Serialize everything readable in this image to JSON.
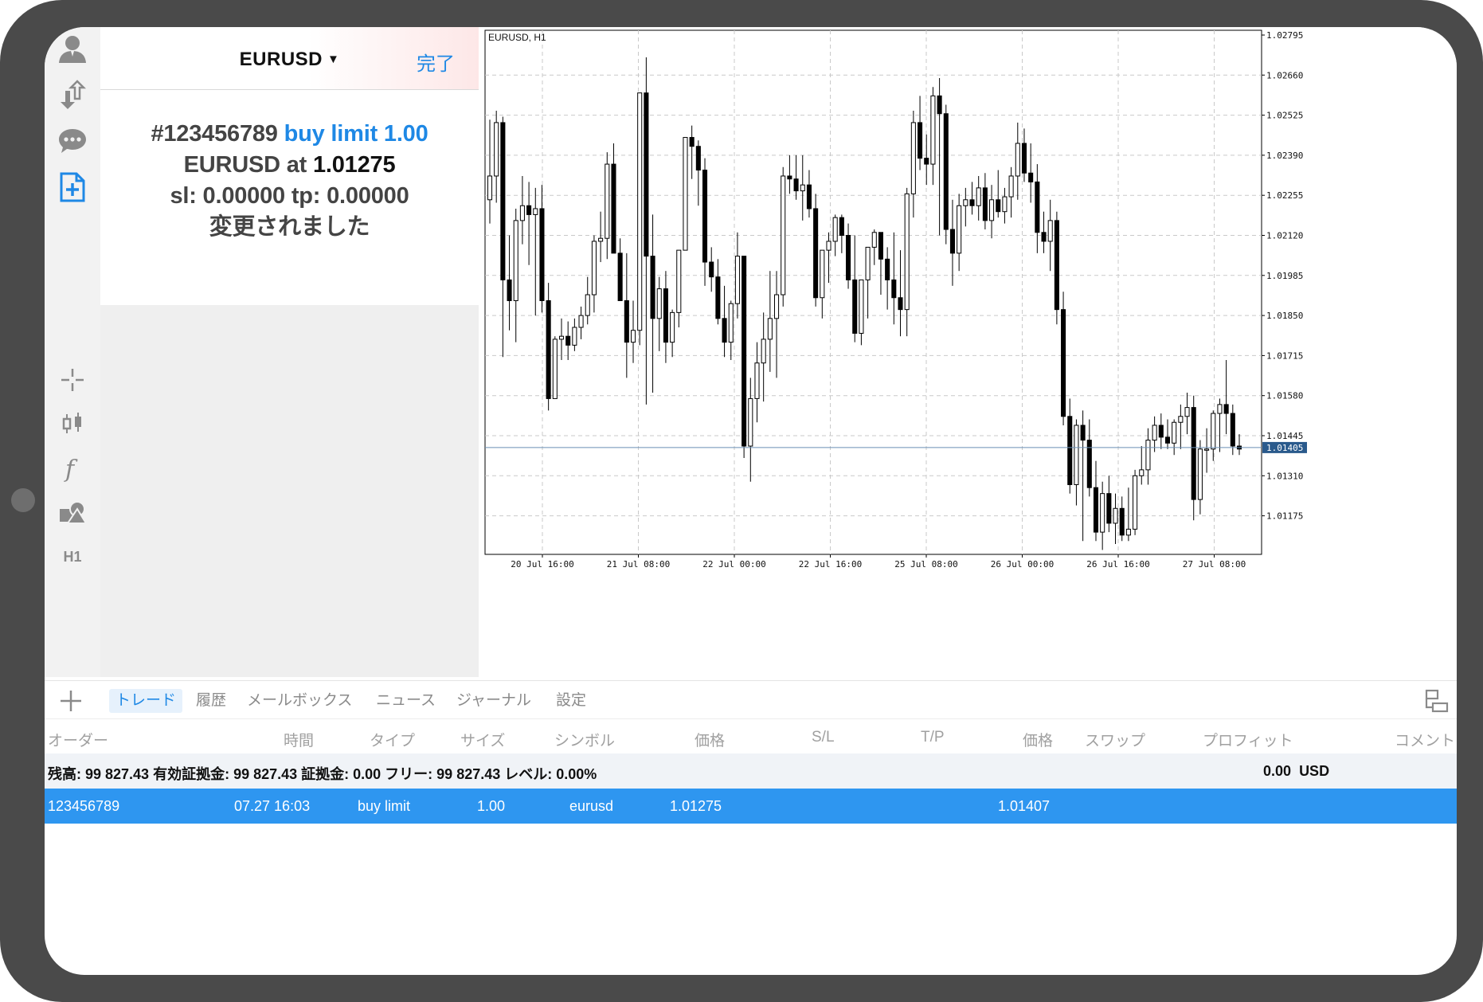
{
  "toolbar": {
    "items": [
      {
        "name": "quotes",
        "icon": "user-icon"
      },
      {
        "name": "charts",
        "icon": "trade-arrows-icon"
      },
      {
        "name": "messages",
        "icon": "chat-bubble-icon"
      },
      {
        "name": "new-order",
        "icon": "new-order-document-icon"
      },
      {
        "name": "crosshair",
        "icon": "crosshair-icon"
      },
      {
        "name": "chart-type",
        "icon": "candles-icon"
      },
      {
        "name": "indicators",
        "icon": "function-icon"
      },
      {
        "name": "objects",
        "icon": "objects-icon"
      }
    ],
    "timeframe": "H1"
  },
  "panel": {
    "symbol": "EURUSD",
    "caret": "▼",
    "done_label": "完了",
    "msg_ticket": "#123456789",
    "msg_type_volume": "buy limit 1.00",
    "msg_symbol_at": "EURUSD at",
    "msg_price": "1.01275",
    "msg_sltp": "sl: 0.00000 tp: 0.00000",
    "msg_status": "変更されました"
  },
  "chart": {
    "title": "EURUSD, H1",
    "current_price": "1.01405",
    "current_price_value": 1.01405,
    "price_labels": [
      "1.02795",
      "1.02660",
      "1.02525",
      "1.02390",
      "1.02255",
      "1.02120",
      "1.01985",
      "1.01850",
      "1.01715",
      "1.01580",
      "1.01445",
      "1.01310",
      "1.01175"
    ],
    "time_labels": [
      "20 Jul 16:00",
      "21 Jul 08:00",
      "22 Jul 00:00",
      "22 Jul 16:00",
      "25 Jul 08:00",
      "26 Jul 00:00",
      "26 Jul 16:00",
      "27 Jul 08:00"
    ],
    "colors": {
      "up": "#ffffff",
      "down": "#000000",
      "wick": "#000000",
      "grid": "#c9c9c9",
      "bidline": "#6a8fb5",
      "price_tag": "#2a5a8c"
    }
  },
  "chart_data": {
    "type": "candlestick",
    "title": "EURUSD, H1",
    "ylim": [
      1.0106,
      1.02795
    ],
    "candles": [
      [
        1.0224,
        1.0251,
        1.0216,
        1.0232
      ],
      [
        1.0232,
        1.0254,
        1.0223,
        1.025
      ],
      [
        1.025,
        1.0252,
        1.0171,
        1.0197
      ],
      [
        1.0197,
        1.0212,
        1.018,
        1.019
      ],
      [
        1.019,
        1.0221,
        1.0176,
        1.0217
      ],
      [
        1.0217,
        1.0232,
        1.0209,
        1.0222
      ],
      [
        1.0222,
        1.023,
        1.0202,
        1.0219
      ],
      [
        1.0219,
        1.0228,
        1.0185,
        1.0221
      ],
      [
        1.0221,
        1.0229,
        1.0186,
        1.019
      ],
      [
        1.019,
        1.0196,
        1.0153,
        1.0157
      ],
      [
        1.0157,
        1.0178,
        1.0157,
        1.0177
      ],
      [
        1.0177,
        1.0184,
        1.017,
        1.0178
      ],
      [
        1.0178,
        1.0183,
        1.017,
        1.0175
      ],
      [
        1.0175,
        1.0184,
        1.0173,
        1.0181
      ],
      [
        1.0181,
        1.0188,
        1.0177,
        1.0185
      ],
      [
        1.0185,
        1.0198,
        1.0182,
        1.0192
      ],
      [
        1.0192,
        1.0212,
        1.0186,
        1.021
      ],
      [
        1.021,
        1.022,
        1.0203,
        1.0211
      ],
      [
        1.0211,
        1.024,
        1.0204,
        1.0236
      ],
      [
        1.0236,
        1.0243,
        1.0206,
        1.0206
      ],
      [
        1.0206,
        1.0211,
        1.019,
        1.019
      ],
      [
        1.019,
        1.0206,
        1.0164,
        1.0176
      ],
      [
        1.0176,
        1.019,
        1.0169,
        1.018
      ],
      [
        1.018,
        1.026,
        1.0175,
        1.026
      ],
      [
        1.026,
        1.0272,
        1.0155,
        1.0205
      ],
      [
        1.0205,
        1.0219,
        1.0159,
        1.0184
      ],
      [
        1.0184,
        1.0198,
        1.0173,
        1.0194
      ],
      [
        1.0194,
        1.02,
        1.0169,
        1.0176
      ],
      [
        1.0176,
        1.0187,
        1.0171,
        1.0186
      ],
      [
        1.0186,
        1.0206,
        1.0181,
        1.0207
      ],
      [
        1.0207,
        1.0237,
        1.0207,
        1.0245
      ],
      [
        1.0245,
        1.0249,
        1.0231,
        1.0242
      ],
      [
        1.0242,
        1.0244,
        1.0222,
        1.0234
      ],
      [
        1.0234,
        1.0238,
        1.0195,
        1.0203
      ],
      [
        1.0203,
        1.0208,
        1.0193,
        1.0198
      ],
      [
        1.0198,
        1.0204,
        1.0182,
        1.0184
      ],
      [
        1.0184,
        1.0195,
        1.0171,
        1.0176
      ],
      [
        1.0176,
        1.019,
        1.017,
        1.0189
      ],
      [
        1.0189,
        1.0213,
        1.0184,
        1.0205
      ],
      [
        1.0205,
        1.0205,
        1.0137,
        1.0141
      ],
      [
        1.0141,
        1.0164,
        1.0129,
        1.0157
      ],
      [
        1.0157,
        1.0176,
        1.0149,
        1.0169
      ],
      [
        1.0169,
        1.0186,
        1.0156,
        1.0177
      ],
      [
        1.0177,
        1.02,
        1.0166,
        1.0184
      ],
      [
        1.0184,
        1.02,
        1.0164,
        1.0192
      ],
      [
        1.0192,
        1.0235,
        1.0188,
        1.0232
      ],
      [
        1.0232,
        1.0239,
        1.0226,
        1.0231
      ],
      [
        1.0231,
        1.0239,
        1.0224,
        1.0227
      ],
      [
        1.0227,
        1.0239,
        1.0217,
        1.0229
      ],
      [
        1.0229,
        1.0234,
        1.0218,
        1.0221
      ],
      [
        1.0221,
        1.0226,
        1.0188,
        1.0191
      ],
      [
        1.0191,
        1.0206,
        1.0184,
        1.0207
      ],
      [
        1.0207,
        1.0213,
        1.0196,
        1.021
      ],
      [
        1.021,
        1.0219,
        1.0205,
        1.0218
      ],
      [
        1.0218,
        1.0219,
        1.0206,
        1.0212
      ],
      [
        1.0212,
        1.0216,
        1.0194,
        1.0197
      ],
      [
        1.0197,
        1.0212,
        1.0176,
        1.0179
      ],
      [
        1.0179,
        1.0189,
        1.0175,
        1.0197
      ],
      [
        1.0197,
        1.0205,
        1.0184,
        1.0208
      ],
      [
        1.0208,
        1.0214,
        1.0202,
        1.0213
      ],
      [
        1.0213,
        1.0212,
        1.0192,
        1.0204
      ],
      [
        1.0204,
        1.0208,
        1.0187,
        1.0197
      ],
      [
        1.0197,
        1.0213,
        1.0182,
        1.0191
      ],
      [
        1.0191,
        1.0207,
        1.0178,
        1.0187
      ],
      [
        1.0187,
        1.0228,
        1.0178,
        1.0226
      ],
      [
        1.0226,
        1.0254,
        1.0218,
        1.025
      ],
      [
        1.025,
        1.0259,
        1.0234,
        1.0238
      ],
      [
        1.0238,
        1.0246,
        1.0229,
        1.0236
      ],
      [
        1.0236,
        1.0262,
        1.0229,
        1.0259
      ],
      [
        1.0259,
        1.0265,
        1.0212,
        1.0253
      ],
      [
        1.0253,
        1.0256,
        1.0209,
        1.0214
      ],
      [
        1.0214,
        1.0224,
        1.0195,
        1.0206
      ],
      [
        1.0206,
        1.0226,
        1.02,
        1.0222
      ],
      [
        1.0222,
        1.0228,
        1.0215,
        1.0224
      ],
      [
        1.0224,
        1.023,
        1.0219,
        1.0222
      ],
      [
        1.0222,
        1.0232,
        1.0217,
        1.0228
      ],
      [
        1.0228,
        1.0233,
        1.0214,
        1.0217
      ],
      [
        1.0217,
        1.0229,
        1.0211,
        1.0224
      ],
      [
        1.0224,
        1.0234,
        1.0218,
        1.022
      ],
      [
        1.022,
        1.0228,
        1.0216,
        1.0225
      ],
      [
        1.0225,
        1.0235,
        1.0218,
        1.0232
      ],
      [
        1.0232,
        1.025,
        1.0224,
        1.0243
      ],
      [
        1.0243,
        1.0248,
        1.023,
        1.0233
      ],
      [
        1.0233,
        1.0243,
        1.0223,
        1.023
      ],
      [
        1.023,
        1.0236,
        1.0206,
        1.0213
      ],
      [
        1.0213,
        1.022,
        1.0206,
        1.021
      ],
      [
        1.021,
        1.0224,
        1.02,
        1.0217
      ],
      [
        1.0217,
        1.022,
        1.0182,
        1.0187
      ],
      [
        1.0187,
        1.0193,
        1.0148,
        1.0151
      ],
      [
        1.0151,
        1.0157,
        1.0125,
        1.0128
      ],
      [
        1.0128,
        1.015,
        1.0121,
        1.0148
      ],
      [
        1.0148,
        1.0153,
        1.0109,
        1.0143
      ],
      [
        1.0143,
        1.015,
        1.0124,
        1.0127
      ],
      [
        1.0127,
        1.0136,
        1.0109,
        1.0112
      ],
      [
        1.0112,
        1.0129,
        1.0106,
        1.0125
      ],
      [
        1.0125,
        1.0131,
        1.0112,
        1.0115
      ],
      [
        1.0115,
        1.0125,
        1.0108,
        1.012
      ],
      [
        1.012,
        1.0124,
        1.0109,
        1.0111
      ],
      [
        1.0111,
        1.0127,
        1.0109,
        1.0113
      ],
      [
        1.0113,
        1.0133,
        1.0111,
        1.0131
      ],
      [
        1.0131,
        1.0141,
        1.0128,
        1.0133
      ],
      [
        1.0133,
        1.0147,
        1.0128,
        1.0143
      ],
      [
        1.0143,
        1.0151,
        1.0139,
        1.0148
      ],
      [
        1.0148,
        1.0152,
        1.014,
        1.0144
      ],
      [
        1.0144,
        1.015,
        1.014,
        1.0142
      ],
      [
        1.0142,
        1.015,
        1.0138,
        1.0149
      ],
      [
        1.0149,
        1.0155,
        1.014,
        1.0151
      ],
      [
        1.0151,
        1.0159,
        1.0145,
        1.0154
      ],
      [
        1.0154,
        1.0158,
        1.0116,
        1.0123
      ],
      [
        1.0123,
        1.0143,
        1.0118,
        1.014
      ],
      [
        1.014,
        1.0147,
        1.0132,
        1.014
      ],
      [
        1.014,
        1.0153,
        1.0136,
        1.0152
      ],
      [
        1.0152,
        1.0157,
        1.0139,
        1.0155
      ],
      [
        1.0155,
        1.017,
        1.0145,
        1.0152
      ],
      [
        1.0152,
        1.0155,
        1.0138,
        1.0141
      ],
      [
        1.0141,
        1.0145,
        1.0138,
        1.014
      ]
    ]
  },
  "tabs": [
    {
      "label": "トレード",
      "active": true
    },
    {
      "label": "履歴",
      "active": false
    },
    {
      "label": "メールボックス",
      "active": false
    },
    {
      "label": "ニュース",
      "active": false
    },
    {
      "label": "ジャーナル",
      "active": false
    },
    {
      "label": "設定",
      "active": false
    }
  ],
  "columns": [
    "オーダー",
    "時間",
    "タイプ",
    "サイズ",
    "シンボル",
    "価格",
    "S/L",
    "T/P",
    "価格",
    "スワップ",
    "プロフィット",
    "コメント"
  ],
  "balance": {
    "text": "残高: 99 827.43 有効証拠金: 99 827.43 証拠金: 0.00 フリー: 99 827.43 レベル: 0.00%",
    "profit": "0.00",
    "currency": "USD"
  },
  "order": {
    "ticket": "123456789",
    "time": "07.27 16:03",
    "type": "buy limit",
    "size": "1.00",
    "symbol": "eurusd",
    "price": "1.01275",
    "current_price": "1.01407"
  }
}
